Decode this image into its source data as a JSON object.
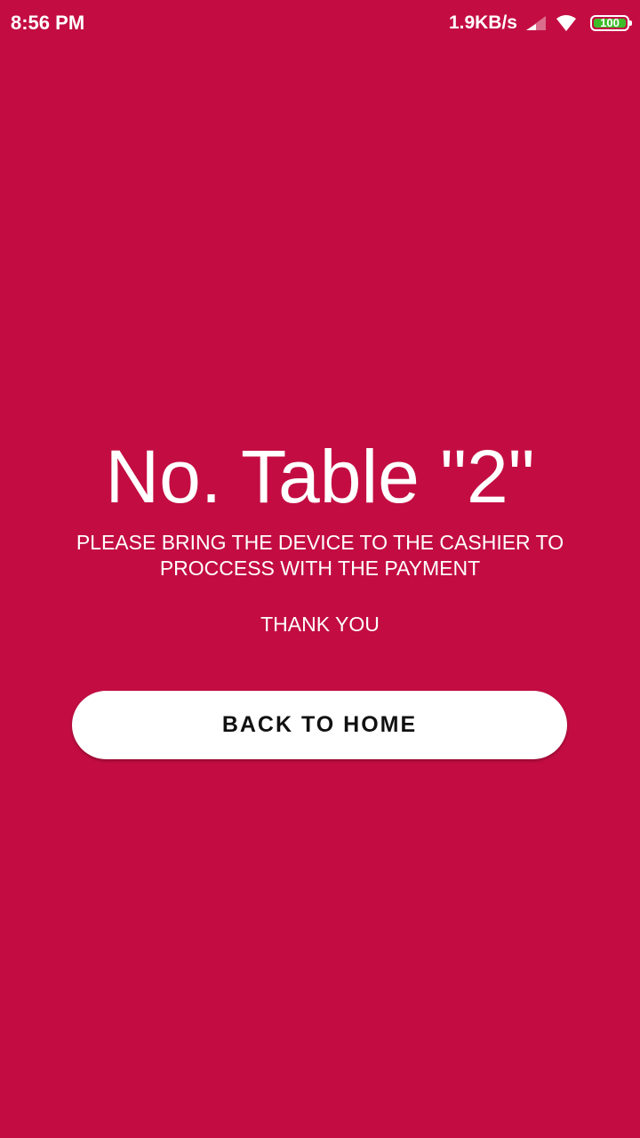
{
  "status_bar": {
    "time": "8:56 PM",
    "net_speed": "1.9KB/s",
    "battery_level": "100",
    "icons": [
      "signal-icon",
      "wifi-icon",
      "battery-icon"
    ]
  },
  "main": {
    "table_title": "No. Table \"2\"",
    "instruction": "PLEASE BRING THE DEVICE TO THE CASHIER TO PROCCESS WITH THE PAYMENT",
    "thank_you": "THANK YOU",
    "back_button_label": "BACK TO HOME"
  },
  "colors": {
    "background": "#C30D42",
    "text": "#FFFFFF",
    "button_bg": "#FFFFFF",
    "button_text": "#111111",
    "battery_fill": "#3DBE29"
  }
}
